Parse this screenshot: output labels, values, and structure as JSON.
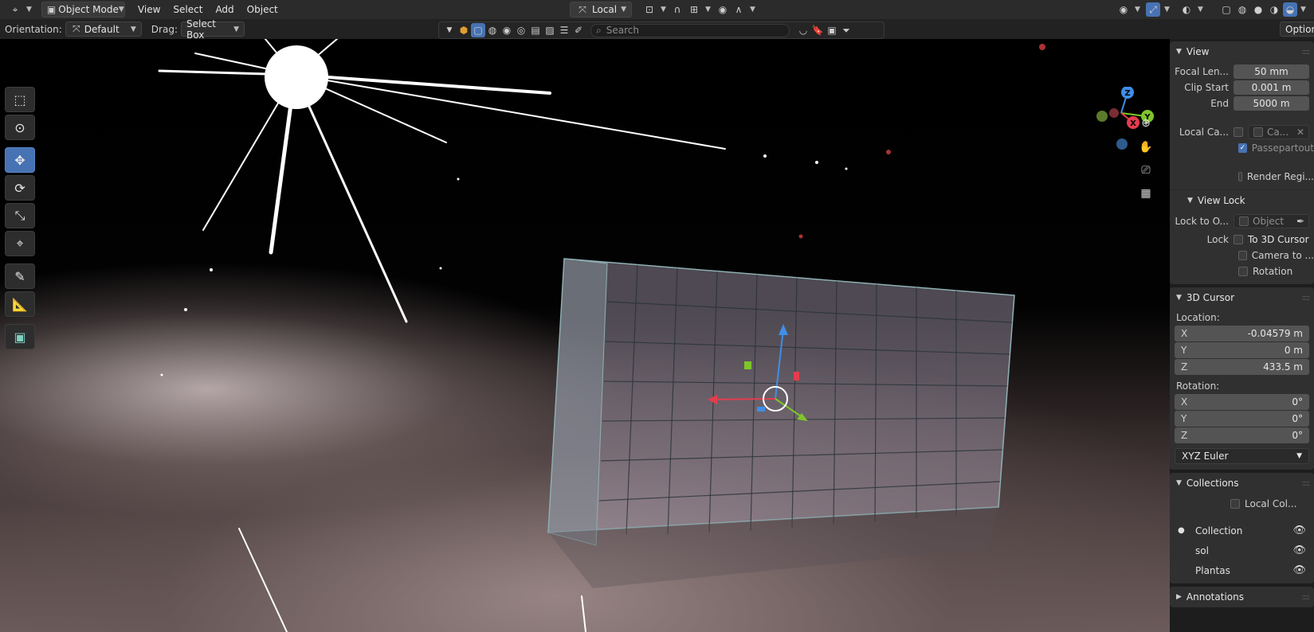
{
  "header": {
    "editor_type_icon": "axis-icon",
    "mode": "Object Mode",
    "menus": [
      "View",
      "Select",
      "Add",
      "Object"
    ],
    "transform_orientation": "Local",
    "options_label": "Options"
  },
  "tool_settings": {
    "orientation_label": "Orientation:",
    "orientation_value": "Default",
    "drag_label": "Drag:",
    "drag_value": "Select Box",
    "search_placeholder": "Search"
  },
  "toolbar": {
    "tools": [
      "select-box-icon",
      "cursor-icon",
      "move-icon",
      "rotate-icon",
      "scale-icon",
      "transform-icon",
      "annotate-icon",
      "measure-icon",
      "add-cube-icon"
    ],
    "active_tool": "move-icon"
  },
  "gizmo": {
    "axes": [
      "Z",
      "Y",
      "X"
    ]
  },
  "sidebar": {
    "view": {
      "title": "View",
      "focal_length_label": "Focal Len...",
      "focal_length_value": "50 mm",
      "clip_start_label": "Clip Start",
      "clip_start_value": "0.001 m",
      "clip_end_label": "End",
      "clip_end_value": "5000 m",
      "local_camera_label": "Local Ca...",
      "local_camera_value": "Ca...",
      "passepartout_label": "Passepartout",
      "passepartout_checked": true,
      "render_region_label": "Render Regi...",
      "render_region_checked": false
    },
    "view_lock": {
      "title": "View Lock",
      "lock_to_object_label": "Lock to O...",
      "lock_to_object_placeholder": "Object",
      "lock_label": "Lock",
      "to_3d_cursor": "To 3D Cursor",
      "camera_to_view": "Camera to ...",
      "rotation": "Rotation"
    },
    "cursor": {
      "title": "3D Cursor",
      "location_label": "Location:",
      "location": [
        {
          "axis": "X",
          "value": "-0.04579 m"
        },
        {
          "axis": "Y",
          "value": "0 m"
        },
        {
          "axis": "Z",
          "value": "433.5 m"
        }
      ],
      "rotation_label": "Rotation:",
      "rotation": [
        {
          "axis": "X",
          "value": "0°"
        },
        {
          "axis": "Y",
          "value": "0°"
        },
        {
          "axis": "Z",
          "value": "0°"
        }
      ],
      "rotation_mode": "XYZ Euler"
    },
    "collections": {
      "title": "Collections",
      "local_collections_label": "Local Col...",
      "items": [
        "Collection",
        "sol",
        "Plantas"
      ]
    },
    "annotations": {
      "title": "Annotations"
    }
  }
}
